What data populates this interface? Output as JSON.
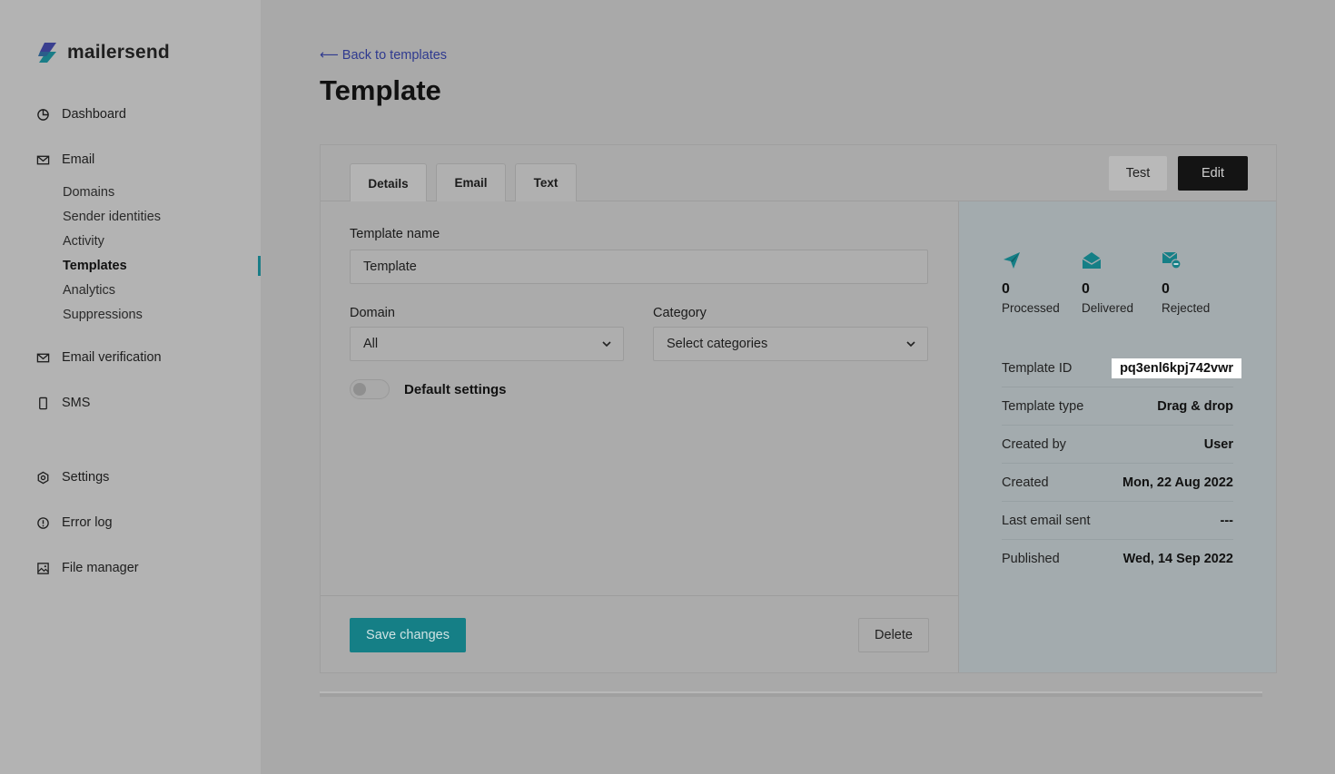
{
  "brand": {
    "name": "mailersend"
  },
  "sidebar": {
    "dashboard": "Dashboard",
    "email": "Email",
    "email_sub": [
      "Domains",
      "Sender identities",
      "Activity",
      "Templates",
      "Analytics",
      "Suppressions"
    ],
    "email_verification": "Email verification",
    "sms": "SMS",
    "settings": "Settings",
    "error_log": "Error log",
    "file_manager": "File manager"
  },
  "header": {
    "back_link": "Back to templates",
    "title": "Template"
  },
  "tabs": [
    "Details",
    "Email",
    "Text"
  ],
  "actions": {
    "test": "Test",
    "edit": "Edit"
  },
  "form": {
    "name_label": "Template name",
    "name_value": "Template",
    "domain_label": "Domain",
    "domain_value": "All",
    "category_label": "Category",
    "category_value": "Select categories",
    "default_settings_label": "Default settings",
    "default_settings_on": false,
    "save_label": "Save changes",
    "delete_label": "Delete"
  },
  "stats": [
    {
      "value": "0",
      "label": "Processed"
    },
    {
      "value": "0",
      "label": "Delivered"
    },
    {
      "value": "0",
      "label": "Rejected"
    }
  ],
  "info": {
    "template_id": {
      "label": "Template ID",
      "value": "pq3enl6kpj742vwr"
    },
    "template_type": {
      "label": "Template type",
      "value": "Drag & drop"
    },
    "created_by": {
      "label": "Created by",
      "value": "User"
    },
    "created": {
      "label": "Created",
      "value": "Mon, 22 Aug 2022"
    },
    "last_email_sent": {
      "label": "Last email sent",
      "value": "---"
    },
    "published": {
      "label": "Published",
      "value": "Wed, 14 Sep 2022"
    }
  },
  "colors": {
    "accent": "#157f86",
    "link": "#2f3a8f",
    "dark_button": "#141414"
  }
}
